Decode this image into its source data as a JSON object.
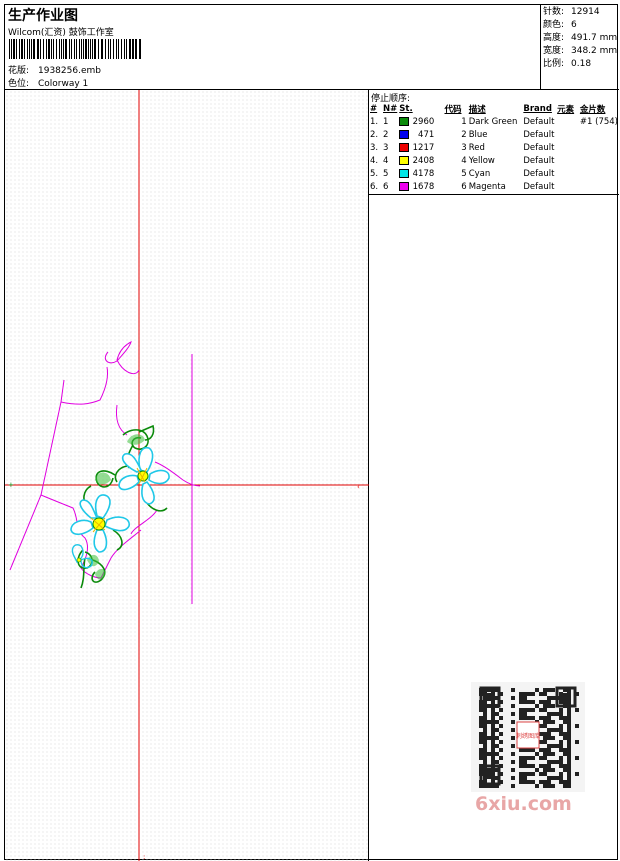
{
  "header": {
    "title": "生产作业图",
    "company": "Wilcom(汇资) 鼓饰工作室",
    "design_label": "花版:",
    "design_value": "1938256.emb",
    "colorway_label": "色位:",
    "colorway_value": "Colorway 1"
  },
  "specs": [
    {
      "label": "针数:",
      "value": "12914"
    },
    {
      "label": "颜色:",
      "value": "6"
    },
    {
      "label": "高度:",
      "value": "491.7 mm"
    },
    {
      "label": "宽度:",
      "value": "348.2 mm"
    },
    {
      "label": "比例:",
      "value": "0.18"
    }
  ],
  "stops": {
    "caption": "停止顺序:",
    "columns": [
      "#",
      "N#",
      "St.",
      "代码",
      "描述",
      "Brand",
      "元素",
      "金片数"
    ],
    "rows": [
      {
        "no": "1.",
        "n": "1",
        "color": "#0a8a0a",
        "st": "2960",
        "code": "1",
        "desc": "Dark Green",
        "brand": "Default",
        "elem": "",
        "sequin": "#1 (754)"
      },
      {
        "no": "2.",
        "n": "2",
        "color": "#0000ee",
        "st": "471",
        "code": "2",
        "desc": "Blue",
        "brand": "Default",
        "elem": "",
        "sequin": ""
      },
      {
        "no": "3.",
        "n": "3",
        "color": "#ee0000",
        "st": "1217",
        "code": "3",
        "desc": "Red",
        "brand": "Default",
        "elem": "",
        "sequin": ""
      },
      {
        "no": "4.",
        "n": "4",
        "color": "#ffff00",
        "st": "2408",
        "code": "4",
        "desc": "Yellow",
        "brand": "Default",
        "elem": "",
        "sequin": ""
      },
      {
        "no": "5.",
        "n": "5",
        "color": "#00e5e5",
        "st": "4178",
        "code": "5",
        "desc": "Cyan",
        "brand": "Default",
        "elem": "",
        "sequin": ""
      },
      {
        "no": "6.",
        "n": "6",
        "color": "#ee00ee",
        "st": "1678",
        "code": "6",
        "desc": "Magenta",
        "brand": "Default",
        "elem": "",
        "sequin": ""
      }
    ]
  },
  "watermark": {
    "qr_badge": "刺绣图库",
    "brand": "6xiu.com"
  },
  "colors": {
    "crosshair": "#e00000",
    "outline": "#e000e0"
  }
}
